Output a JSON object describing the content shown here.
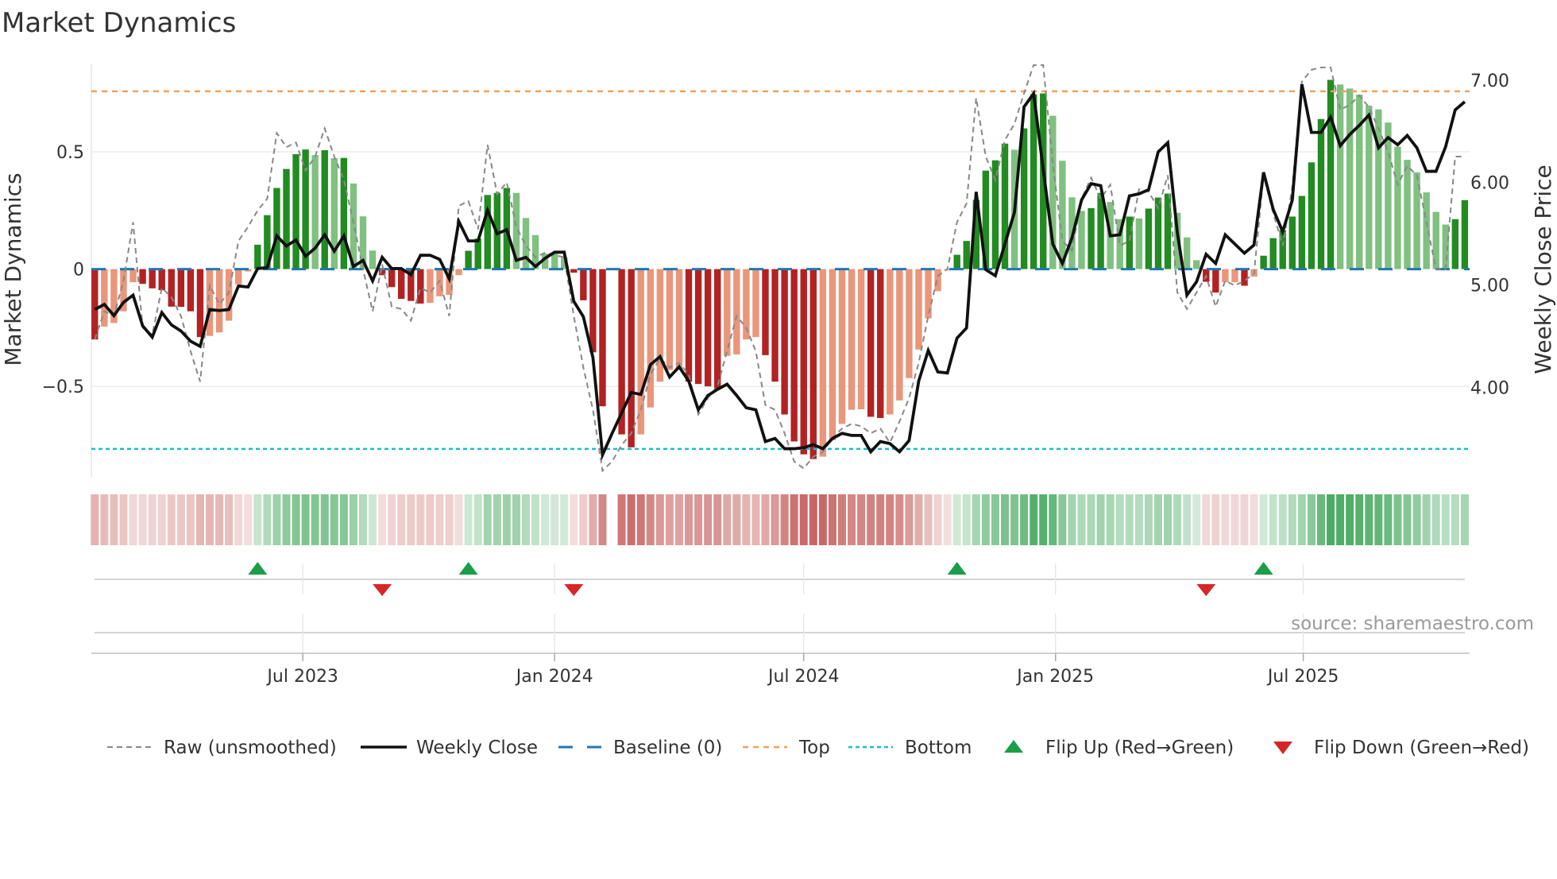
{
  "title": "Market Dynamics",
  "source": "source: sharemaestro.com",
  "colors": {
    "dark_red": "#b22222",
    "light_red": "#e9967a",
    "dark_green": "#228b22",
    "light_green": "#80c080",
    "baseline": "#1f77b4",
    "top": "#f0a060",
    "bottom": "#17becf",
    "raw": "#888888",
    "close": "#111111",
    "flip_up": "#1a9e4a",
    "flip_down": "#d62728",
    "heat_red": "#c0504d",
    "heat_green": "#2e9e4a"
  },
  "chart_data": {
    "type": "bar",
    "title": "Market Dynamics",
    "frequency": "weekly",
    "start_date": "2023-01-30",
    "ylabel": "Market Dynamics",
    "y2label": "Weekly Close Price",
    "ylim": [
      -0.886,
      0.873
    ],
    "y2lim": [
      3.125,
      7.155
    ],
    "yticks": [
      {
        "v": 0.5,
        "label": "0.5"
      },
      {
        "v": 0,
        "label": "0"
      },
      {
        "v": -0.5,
        "label": "−0.5"
      }
    ],
    "y2ticks": [
      {
        "v": 7,
        "label": "7.00"
      },
      {
        "v": 6,
        "label": "6.00"
      },
      {
        "v": 5,
        "label": "5.00"
      },
      {
        "v": 4,
        "label": "4.00"
      }
    ],
    "xticks": [
      {
        "date": "2023-07-01",
        "label": "Jul 2023"
      },
      {
        "date": "2024-01-01",
        "label": "Jan 2024"
      },
      {
        "date": "2024-07-01",
        "label": "Jul 2024"
      },
      {
        "date": "2025-01-01",
        "label": "Jan 2025"
      },
      {
        "date": "2025-07-01",
        "label": "Jul 2025"
      }
    ],
    "top": 0.758,
    "bottom": -0.767,
    "baseline": 0,
    "values": [
      -0.3,
      -0.245,
      -0.23,
      -0.18,
      -0.056,
      -0.063,
      -0.082,
      -0.09,
      -0.16,
      -0.161,
      -0.18,
      -0.29,
      -0.285,
      -0.27,
      -0.22,
      -0.065,
      -0.01,
      0.104,
      0.23,
      0.346,
      0.427,
      0.49,
      0.51,
      0.486,
      0.507,
      0.473,
      0.474,
      0.365,
      0.225,
      0.079,
      -0.026,
      -0.077,
      -0.127,
      -0.136,
      -0.147,
      -0.144,
      -0.116,
      -0.11,
      -0.026,
      0.078,
      0.13,
      0.316,
      0.325,
      0.346,
      0.325,
      0.218,
      0.145,
      0.066,
      0.066,
      0.05,
      -0.015,
      -0.133,
      -0.355,
      -0.585,
      null,
      -0.705,
      -0.76,
      -0.705,
      -0.59,
      -0.48,
      -0.43,
      -0.425,
      -0.48,
      -0.49,
      -0.5,
      -0.51,
      -0.37,
      -0.364,
      -0.3,
      -0.29,
      -0.367,
      -0.48,
      -0.62,
      -0.735,
      -0.79,
      -0.81,
      -0.8,
      -0.73,
      -0.66,
      -0.6,
      -0.598,
      -0.63,
      -0.635,
      -0.62,
      -0.56,
      -0.465,
      -0.343,
      -0.21,
      -0.094,
      -0.005,
      0.061,
      0.12,
      0.295,
      0.42,
      0.464,
      0.535,
      0.509,
      0.6,
      0.745,
      0.749,
      0.654,
      0.462,
      0.306,
      0.248,
      0.26,
      0.325,
      0.286,
      0.213,
      0.224,
      0.216,
      0.258,
      0.305,
      0.322,
      0.24,
      0.135,
      0.038,
      -0.054,
      -0.1,
      -0.056,
      -0.056,
      -0.071,
      -0.032,
      0.057,
      0.132,
      0.166,
      0.224,
      0.312,
      0.455,
      0.64,
      0.807,
      0.787,
      0.77,
      0.744,
      0.697,
      0.681,
      0.625,
      0.522,
      0.466,
      0.413,
      0.327,
      0.244,
      0.19,
      0.213,
      0.294
    ],
    "raw": [
      -0.3,
      -0.18,
      -0.2,
      -0.05,
      0.2,
      -0.25,
      -0.28,
      -0.08,
      -0.12,
      -0.2,
      -0.35,
      -0.48,
      -0.07,
      -0.15,
      -0.1,
      0.12,
      0.18,
      0.25,
      0.3,
      0.58,
      0.52,
      0.54,
      0.42,
      0.48,
      0.6,
      0.48,
      0.38,
      0.2,
      0.0,
      -0.18,
      0.02,
      -0.16,
      -0.17,
      -0.22,
      -0.08,
      -0.1,
      -0.05,
      -0.2,
      0.27,
      0.29,
      0.17,
      0.53,
      0.32,
      0.37,
      0.18,
      0.1,
      0.05,
      0.07,
      0.06,
      0.05,
      -0.2,
      -0.42,
      -0.6,
      -0.86,
      -0.82,
      -0.75,
      -0.7,
      -0.6,
      -0.45,
      -0.38,
      -0.42,
      -0.4,
      -0.45,
      -0.62,
      -0.55,
      -0.5,
      -0.35,
      -0.2,
      -0.25,
      -0.35,
      -0.58,
      -0.6,
      -0.7,
      -0.82,
      -0.85,
      -0.8,
      -0.78,
      -0.72,
      -0.68,
      -0.66,
      -0.67,
      -0.7,
      -0.68,
      -0.74,
      -0.65,
      -0.55,
      -0.4,
      -0.2,
      -0.03,
      0.0,
      0.2,
      0.28,
      0.73,
      0.48,
      0.38,
      0.55,
      0.62,
      0.75,
      0.87,
      0.87,
      0.45,
      0.12,
      0.08,
      0.3,
      0.39,
      0.3,
      0.36,
      0.1,
      0.12,
      0.34,
      0.33,
      0.26,
      0.4,
      -0.1,
      -0.17,
      -0.1,
      -0.03,
      -0.16,
      -0.05,
      -0.07,
      -0.05,
      -0.02,
      0.4,
      0.24,
      0.1,
      0.35,
      0.8,
      0.85,
      0.86,
      0.86,
      0.68,
      0.7,
      0.74,
      0.69,
      0.6,
      0.5,
      0.36,
      0.44,
      0.4,
      0.2,
      0.0,
      0.0,
      0.48,
      0.48
    ],
    "close": [
      4.76,
      4.81,
      4.7,
      4.83,
      4.9,
      4.6,
      4.49,
      4.73,
      4.61,
      4.55,
      4.45,
      4.4,
      4.76,
      4.75,
      4.76,
      4.99,
      4.98,
      5.16,
      5.17,
      5.48,
      5.38,
      5.44,
      5.28,
      5.36,
      5.49,
      5.33,
      5.48,
      5.18,
      5.24,
      5.04,
      5.27,
      5.16,
      5.16,
      5.1,
      5.29,
      5.29,
      5.25,
      5.06,
      5.62,
      5.43,
      5.43,
      5.73,
      5.5,
      5.54,
      5.24,
      5.27,
      5.18,
      5.26,
      5.32,
      5.32,
      4.84,
      4.69,
      4.29,
      3.34,
      3.55,
      3.75,
      3.95,
      3.93,
      4.22,
      4.3,
      4.1,
      4.2,
      4.06,
      3.78,
      3.92,
      3.98,
      4.03,
      3.92,
      3.8,
      3.78,
      3.47,
      3.5,
      3.4,
      3.4,
      3.41,
      3.44,
      3.4,
      3.5,
      3.55,
      3.53,
      3.53,
      3.37,
      3.47,
      3.45,
      3.37,
      3.48,
      4.06,
      4.36,
      4.15,
      4.14,
      4.48,
      4.58,
      5.91,
      5.15,
      5.09,
      5.4,
      5.71,
      6.74,
      6.87,
      6.13,
      5.4,
      5.21,
      5.46,
      5.83,
      5.99,
      5.97,
      5.48,
      5.49,
      5.87,
      5.89,
      5.93,
      6.3,
      6.39,
      5.51,
      4.9,
      5.03,
      5.3,
      5.21,
      5.49,
      5.4,
      5.31,
      5.39,
      6.1,
      5.74,
      5.52,
      5.83,
      6.96,
      6.49,
      6.49,
      6.64,
      6.36,
      6.47,
      6.56,
      6.66,
      6.34,
      6.44,
      6.37,
      6.46,
      6.34,
      6.11,
      6.11,
      6.35,
      6.71,
      6.79
    ],
    "flip_up_indices": [
      17,
      39,
      90,
      122
    ],
    "flip_down_indices": [
      30,
      50,
      116
    ],
    "legend": {
      "position": "bottom",
      "items": [
        {
          "key": "raw",
          "label": "Raw (unsmoothed)"
        },
        {
          "key": "close",
          "label": "Weekly Close"
        },
        {
          "key": "baseline",
          "label": "Baseline (0)"
        },
        {
          "key": "top",
          "label": "Top"
        },
        {
          "key": "bottom",
          "label": "Bottom"
        },
        {
          "key": "flip_up",
          "label": "Flip Up (Red→Green)"
        },
        {
          "key": "flip_down",
          "label": "Flip Down (Green→Red)"
        }
      ]
    }
  }
}
